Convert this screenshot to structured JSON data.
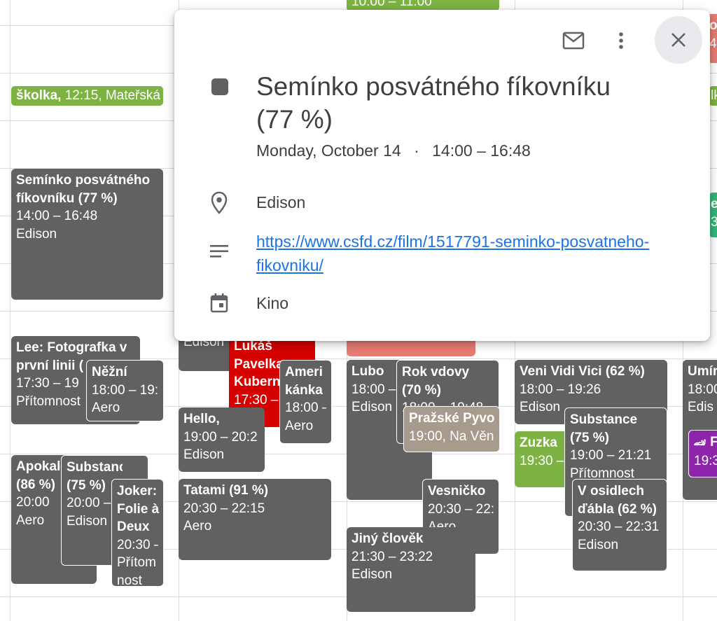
{
  "allday": {
    "text_bold": "školka,",
    "text_rest": " 12:15, Mateřská"
  },
  "popup": {
    "title": "Semínko posvátného fíkovníku (77 %)",
    "date": "Monday, October 14",
    "separator": "·",
    "time": "14:00 – 16:48",
    "location": "Edison",
    "link": "https://www.csfd.cz/film/1517791-seminko-posvatneho-fikovniku/",
    "calendar": "Kino",
    "event_color": "#616161"
  },
  "events": {
    "top_green": {
      "time": "10:00 – 11:00"
    },
    "seminko": {
      "title": "Semínko posvátného fíkovníku (77 %)",
      "time": "14:00 – 16:48",
      "place": "Edison"
    },
    "lee": {
      "title": "Lee: Fotografka v první linii (",
      "time": "17:30 – 19",
      "place": "Přítomnost"
    },
    "nezni": {
      "title": "Něžní",
      "time": "18:00 – 19:",
      "place": "Aero"
    },
    "apokal": {
      "title": "Apokal (86 %)",
      "time": "20:00",
      "place": "Aero"
    },
    "substance1": {
      "title": "Substance (75 %)",
      "time": "20:00 –",
      "place": "Edison"
    },
    "joker": {
      "title": "Joker: Folie à Deux",
      "time": "20:30 –",
      "place": "Přítom nost"
    },
    "edison_stub": {
      "text": "Edison"
    },
    "lukas": {
      "title": "Lukáš Pavelka Kubern",
      "time": "17:30 –"
    },
    "amerikanka": {
      "title": "Ameri kánka",
      "time": "18:00 –",
      "place": "Aero"
    },
    "hello": {
      "title": "Hello,",
      "time": "19:00 – 20:2",
      "place": "Edison"
    },
    "tatami": {
      "title": "Tatami (91 %)",
      "time": "20:30 – 22:15",
      "place": "Aero"
    },
    "lubo": {
      "title": "Lubo",
      "time": "18:00 –",
      "place": "Edison"
    },
    "rokvdovy": {
      "title": "Rok vdovy (70 %)",
      "time": "18:00 – 19:48"
    },
    "prazske": {
      "title": "Pražské Pyvo",
      "time": "19:00, Na Věn"
    },
    "vesnicko": {
      "title": "Vesničko",
      "time": "20:30 – 22:",
      "place": "Aero"
    },
    "jiny": {
      "title": "Jiný člověk",
      "time": "21:30 – 23:22",
      "place": "Edison"
    },
    "veni": {
      "title": "Veni Vidi Vici (62 %)",
      "time": "18:00 – 19:26",
      "place": "Edison"
    },
    "zuzka": {
      "title": "Zuzka",
      "time": "19:30 –"
    },
    "substance2": {
      "title": "Substance (75 %)",
      "time": "19:00 – 21:21",
      "place": "Přítomnost"
    },
    "vosidlech": {
      "title": "V osidlech ďábla (62 %)",
      "time": "20:30 – 22:31",
      "place": "Edison"
    },
    "umir": {
      "title": "Umír",
      "time": "18:00",
      "place": "Edis"
    },
    "purple": {
      "emoji": "🏎",
      "title": "F",
      "time": "19:3"
    },
    "edge_top": {
      "title": "o",
      "time": "45"
    },
    "edge_mid": {
      "text": "lk"
    },
    "edge_green": {
      "title": "er",
      "time": "30"
    }
  }
}
